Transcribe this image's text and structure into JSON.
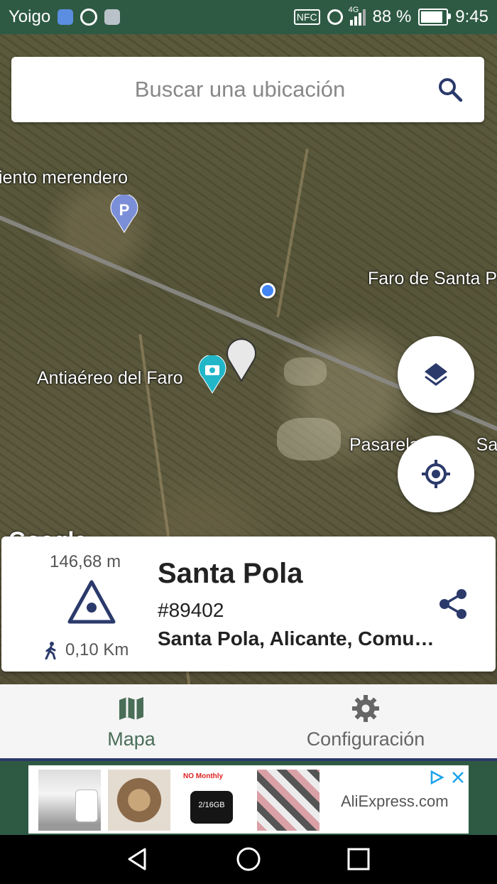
{
  "status_bar": {
    "carrier": "Yoigo",
    "battery": "88 %",
    "battery_level": 0.88,
    "time": "9:45",
    "network": "4G",
    "nfc": "NFC"
  },
  "search": {
    "placeholder": "Buscar una ubicación"
  },
  "map": {
    "labels": {
      "merendero": "iento merendero",
      "faro": "Faro de Santa Po",
      "antiaereo": "Antiaéreo del Faro",
      "pasarela": "Pasarela",
      "pasarela_end": "San"
    },
    "parking_letter": "P",
    "attribution": "Google"
  },
  "info_card": {
    "elevation": "146,68 m",
    "distance": "0,10 Km",
    "name": "Santa Pola",
    "id": "#89402",
    "address": "Santa Pola, Alicante, Comunidad Valenciana"
  },
  "bottom_nav": {
    "tabs": [
      {
        "label": "Mapa",
        "active": true
      },
      {
        "label": "Configuración",
        "active": false
      }
    ]
  },
  "ad": {
    "advertiser": "AliExpress.com",
    "product_caption": "NO Monthly",
    "product_spec": "2/16GB"
  },
  "colors": {
    "status_green": "#2e5a44",
    "active_tab": "#4a6e58",
    "inactive_tab": "#666666",
    "card_icon": "#2b3a6b",
    "pin_parking": "#7b8fd8",
    "pin_camera": "#21b7c9"
  }
}
